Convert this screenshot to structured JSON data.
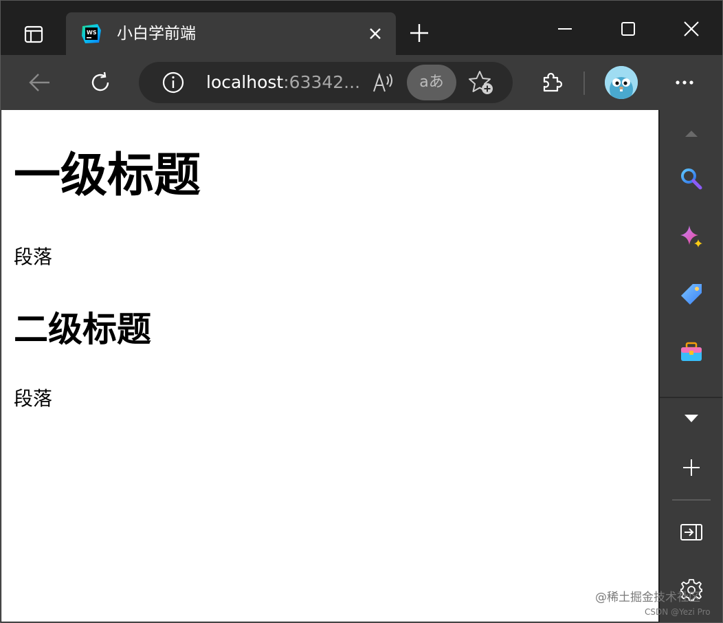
{
  "tab": {
    "title": "小白学前端",
    "favicon": "webstorm-icon"
  },
  "address": {
    "host": "localhost",
    "rest": ":63342...",
    "translate_label": "aあ"
  },
  "page": {
    "h1": "一级标题",
    "p1": "段落",
    "h2": "二级标题",
    "p2": "段落"
  },
  "watermark": {
    "line1": "@稀土掘金技术社区",
    "line2": "CSDN @Yezi Pro"
  },
  "colors": {
    "chrome_dark": "#202020",
    "chrome_mid": "#3b3b3b",
    "address_bg": "#2a2a2a",
    "text_white": "#ffffff",
    "text_muted": "#a8a8a8"
  },
  "sidebar": {
    "items": [
      "search-icon",
      "copilot-sparkle-icon",
      "tag-icon",
      "toolbox-icon",
      "add-icon",
      "split-screen-icon",
      "settings-gear-icon"
    ]
  }
}
